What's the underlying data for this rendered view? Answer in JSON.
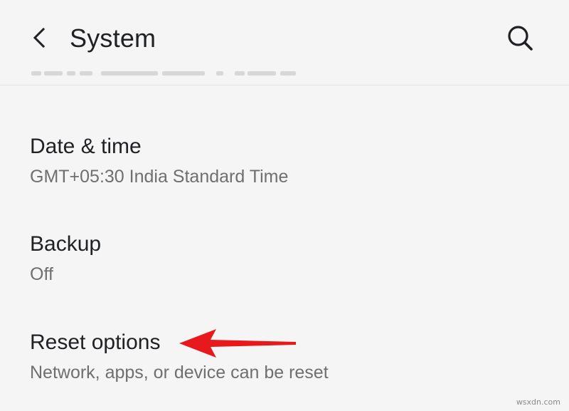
{
  "header": {
    "title": "System",
    "back_icon": "back-arrow-icon",
    "search_icon": "search-icon"
  },
  "settings": [
    {
      "title": "Date & time",
      "summary": "GMT+05:30 India Standard Time"
    },
    {
      "title": "Backup",
      "summary": "Off"
    },
    {
      "title": "Reset options",
      "summary": "Network, apps, or device can be reset"
    }
  ],
  "annotation": {
    "arrow_color": "#e8191c",
    "points_to": "Reset options"
  },
  "watermark": "wsxdn.com",
  "colors": {
    "background": "#f5f5f5",
    "primary_text": "#202124",
    "secondary_text": "#6f6f6f"
  }
}
